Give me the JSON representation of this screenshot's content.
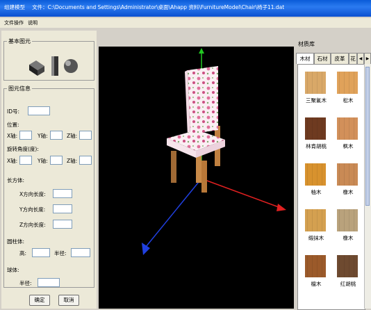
{
  "window": {
    "title_app": "组建模型",
    "title_file": "文件：C:\\Documents and Settings\\Administrator\\桌面\\Ahapp 资料\\FurnitureModel\\Chair\\椅子11.dat"
  },
  "menu": {
    "file": "文件操作",
    "help": "说明"
  },
  "primitives": {
    "legend": "基本图元",
    "items": [
      "cube-block",
      "cylinder",
      "sphere"
    ]
  },
  "properties": {
    "legend": "图元信息",
    "id_label": "ID号:",
    "position_label": "位置:",
    "rotation_label": "旋转角度(度):",
    "x_label": "X轴:",
    "y_label": "Y轴:",
    "z_label": "Z轴:",
    "cuboid_label": "长方体:",
    "x_len_label": "X方向长度:",
    "y_len_label": "Y方向长度:",
    "z_len_label": "Z方向长度:",
    "cylinder_label": "圆柱体:",
    "height_label": "高:",
    "radius_label": "半径:",
    "sphere_label": "球体:",
    "sphere_radius_label": "半径:",
    "ok": "确定",
    "cancel": "取消"
  },
  "library": {
    "title": "材质库",
    "tabs": [
      "木材",
      "石材",
      "皮革",
      "花"
    ],
    "materials": [
      {
        "name": "三聚氰木",
        "color": "#d9a868"
      },
      {
        "name": "松木",
        "color": "#e0a25a"
      },
      {
        "name": "林肯胡桃",
        "color": "#6e3a20"
      },
      {
        "name": "枫木",
        "color": "#d2905a"
      },
      {
        "name": "柚木",
        "color": "#d8922e"
      },
      {
        "name": "橡木",
        "color": "#c98a55"
      },
      {
        "name": "缎抹木",
        "color": "#d4a050"
      },
      {
        "name": "橡木",
        "color": "#b9a27c"
      },
      {
        "name": "檀木",
        "color": "#9b5a2a"
      },
      {
        "name": "红胡桃",
        "color": "#6e4a30"
      }
    ]
  },
  "colors": {
    "title_bar": "#0a5bd8",
    "axis_x": "#e02020",
    "axis_y": "#20c020",
    "axis_z": "#2040e0",
    "wood": "#c8904a"
  }
}
